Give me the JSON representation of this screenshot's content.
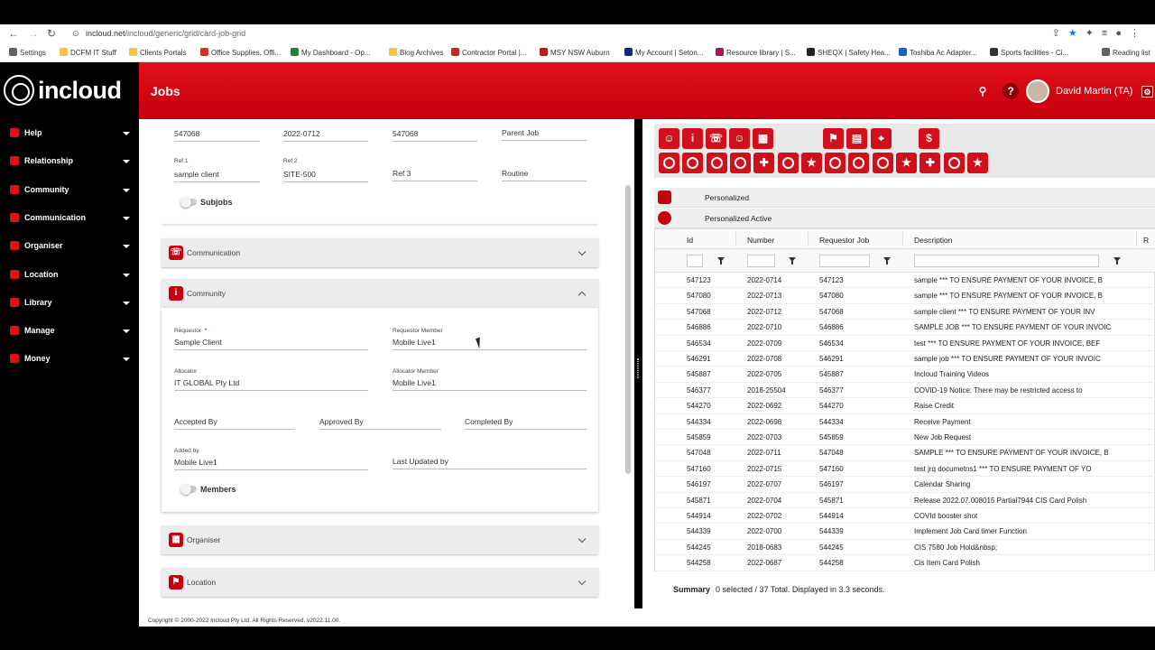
{
  "browser": {
    "url_host": "incloud.net",
    "url_path": "/incloud/generic/grid/card-job-grid",
    "bookmarks": [
      {
        "label": "Settings",
        "color": "#5f6368"
      },
      {
        "label": "DCFM IT Stuff",
        "color": "#f6c342"
      },
      {
        "label": "Clients Portals",
        "color": "#f6c342"
      },
      {
        "label": "Office Supplies, Offi...",
        "color": "#d93025"
      },
      {
        "label": "My Dashboard - Op...",
        "color": "#2e7d32"
      },
      {
        "label": "Blog Archives",
        "color": "#f6c342"
      },
      {
        "label": "Contractor Portal |...",
        "color": "#c62828"
      },
      {
        "label": "MSY NSW Auburn",
        "color": "#b71c1c"
      },
      {
        "label": "My Account | Seton...",
        "color": "#1a237e"
      },
      {
        "label": "Resource library | S...",
        "color": "#ad1457"
      },
      {
        "label": "SHEQX | Safety Hea...",
        "color": "#222222"
      },
      {
        "label": "Toshiba Ac Adapter...",
        "color": "#1565c0"
      },
      {
        "label": "Sports facilities - Ci...",
        "color": "#333333"
      },
      {
        "label": "Reading list",
        "color": "#5f6368"
      }
    ]
  },
  "app": {
    "logo_text": "incloud",
    "title": "Jobs",
    "user_name": "David Martin (TA)",
    "accent_color": "#d0101a"
  },
  "sidebar": {
    "items": [
      {
        "label": "Help"
      },
      {
        "label": "Relationship"
      },
      {
        "label": "Community"
      },
      {
        "label": "Communication"
      },
      {
        "label": "Organiser"
      },
      {
        "label": "Location"
      },
      {
        "label": "Library"
      },
      {
        "label": "Manage"
      },
      {
        "label": "Money"
      }
    ]
  },
  "form": {
    "top": {
      "id": "547068",
      "date": "2022-0712",
      "number": "547068",
      "parent_job_label": "Parent Job",
      "ref1_label": "Ref 1",
      "ref1_value": "sample client",
      "ref2_label": "Ref 2",
      "ref2_value": "SITE-500",
      "ref3_label": "Ref 3",
      "routine_label": "Routine",
      "subjobs_label": "Subjobs"
    },
    "sections": {
      "communication": "Communication",
      "community": "Community",
      "organiser": "Organiser",
      "location": "Location"
    },
    "community": {
      "requestor_label": "Requestor",
      "requestor_required": "*",
      "requestor_value": "Sample Client",
      "requestor_member_label": "Requestor Member",
      "requestor_member_value": "Mobile Live1",
      "allocator_label": "Allocator",
      "allocator_value": "IT GLOBAL Pty Ltd",
      "allocator_member_label": "Allocator Member",
      "allocator_member_value": "Mobile Live1",
      "accepted_by_label": "Accepted By",
      "approved_by_label": "Approved By",
      "completed_by_label": "Completed By",
      "added_by_label": "Added by",
      "added_by_value": "Mobile Live1",
      "last_updated_by_label": "Last Updated by",
      "members_label": "Members"
    }
  },
  "grid": {
    "personalized_label": "Personalized",
    "personalized_active_label": "Personalized Active",
    "columns": [
      "Id",
      "Number",
      "Requestor Job",
      "Description",
      "R"
    ],
    "rows": [
      [
        "547123",
        "2022-0714",
        "547123",
        "sample *** TO ENSURE PAYMENT OF YOUR INVOICE, B"
      ],
      [
        "547080",
        "2022-0713",
        "547080",
        "sample *** TO ENSURE PAYMENT OF YOUR INVOICE, B"
      ],
      [
        "547068",
        "2022-0712",
        "547068",
        "sample client *** TO ENSURE PAYMENT OF YOUR INV"
      ],
      [
        "546886",
        "2022-0710",
        "546886",
        "SAMPLE JOB *** TO ENSURE PAYMENT OF YOUR INVOIC"
      ],
      [
        "546534",
        "2022-0709",
        "546534",
        "test *** TO ENSURE PAYMENT OF YOUR INVOICE, BEF"
      ],
      [
        "546291",
        "2022-0708",
        "546291",
        "sample job *** TO ENSURE PAYMENT OF YOUR INVOIC"
      ],
      [
        "545887",
        "2022-0705",
        "545887",
        "Incloud Training Videos"
      ],
      [
        "546377",
        "2018-25504",
        "546377",
        "COVID-19 Notice: There may be restricted access to"
      ],
      [
        "544270",
        "2022-0692",
        "544270",
        "Raise Credit"
      ],
      [
        "544334",
        "2022-0698",
        "544334",
        "Receive Payment"
      ],
      [
        "545859",
        "2022-0703",
        "545859",
        "New Job Request"
      ],
      [
        "547048",
        "2022-0711",
        "547048",
        "SAMPLE *** TO ENSURE PAYMENT OF YOUR INVOICE, B"
      ],
      [
        "547160",
        "2022-0715",
        "547160",
        "test jrq documetns1 *** TO ENSURE PAYMENT OF YO"
      ],
      [
        "546197",
        "2022-0707",
        "546197",
        "Calendar Sharing"
      ],
      [
        "545871",
        "2022-0704",
        "545871",
        "Release 2022.07.008015 Partial7944 CIS Card Polish"
      ],
      [
        "544914",
        "2022-0702",
        "544914",
        "COVId booster shot"
      ],
      [
        "544339",
        "2022-0700",
        "544339",
        "Implement Job Card timer Function"
      ],
      [
        "544245",
        "2018-0683",
        "544245",
        "CIS 7580 Job Hold&nbsp;"
      ],
      [
        "544258",
        "2022-0687",
        "544258",
        "Cis Item Card Polish"
      ]
    ],
    "summary_label": "Summary",
    "summary_text": "0 selected / 37 Total. Displayed in 3.3 seconds."
  },
  "footer": {
    "copyright": "Copyright © 2000-2022 Incloud Pty Ltd. All Rights Reserved. v2022.11.00."
  }
}
